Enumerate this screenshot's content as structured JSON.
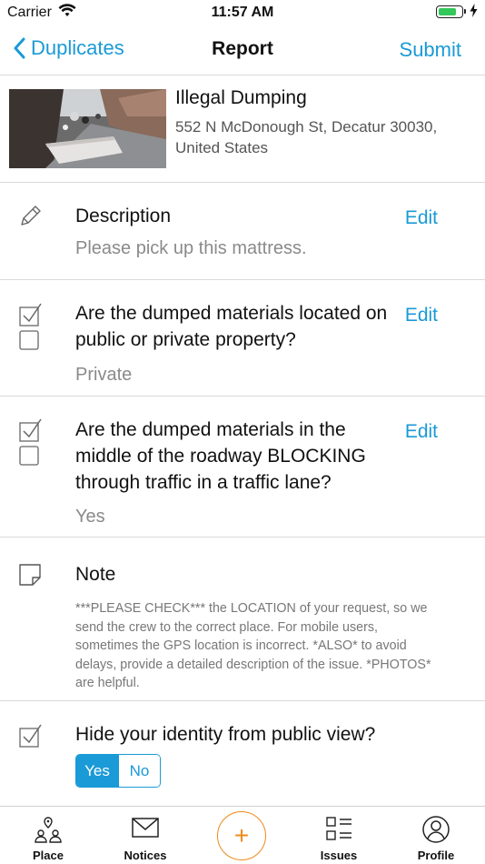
{
  "status_bar": {
    "carrier": "Carrier",
    "time": "11:57 AM",
    "battery_level": 0.75
  },
  "nav": {
    "back_label": "Duplicates",
    "title": "Report",
    "submit_label": "Submit"
  },
  "issue": {
    "title": "Illegal Dumping",
    "address": "552 N McDonough St, Decatur 30030, United States"
  },
  "rows": {
    "description": {
      "title": "Description",
      "value": "Please pick up this mattress.",
      "edit_label": "Edit"
    },
    "question1": {
      "title": "Are the dumped materials located on public or private property?",
      "value": "Private",
      "edit_label": "Edit"
    },
    "question2": {
      "title": "Are the dumped materials in the middle of the roadway BLOCKING through traffic in a traffic lane?",
      "value": "Yes",
      "edit_label": "Edit"
    },
    "note": {
      "title": "Note",
      "text": "***PLEASE CHECK*** the LOCATION of your request, so we send the crew to the correct place. For mobile users, sometimes the GPS location is incorrect. *ALSO* to avoid delays, provide a detailed description of the issue. *PHOTOS* are helpful."
    },
    "hide_identity": {
      "title": "Hide your identity from public view?",
      "yes_label": "Yes",
      "no_label": "No",
      "selected": "Yes"
    }
  },
  "tabbar": {
    "tabs": [
      {
        "label": "Place",
        "icon": "place-icon"
      },
      {
        "label": "Notices",
        "icon": "envelope-icon"
      },
      {
        "label": "+",
        "icon": "plus-icon"
      },
      {
        "label": "Issues",
        "icon": "list-icon"
      },
      {
        "label": "Profile",
        "icon": "profile-icon"
      }
    ]
  },
  "colors": {
    "accent": "#1a9ad6",
    "fab": "#f08a1c",
    "battery": "#34c759"
  }
}
